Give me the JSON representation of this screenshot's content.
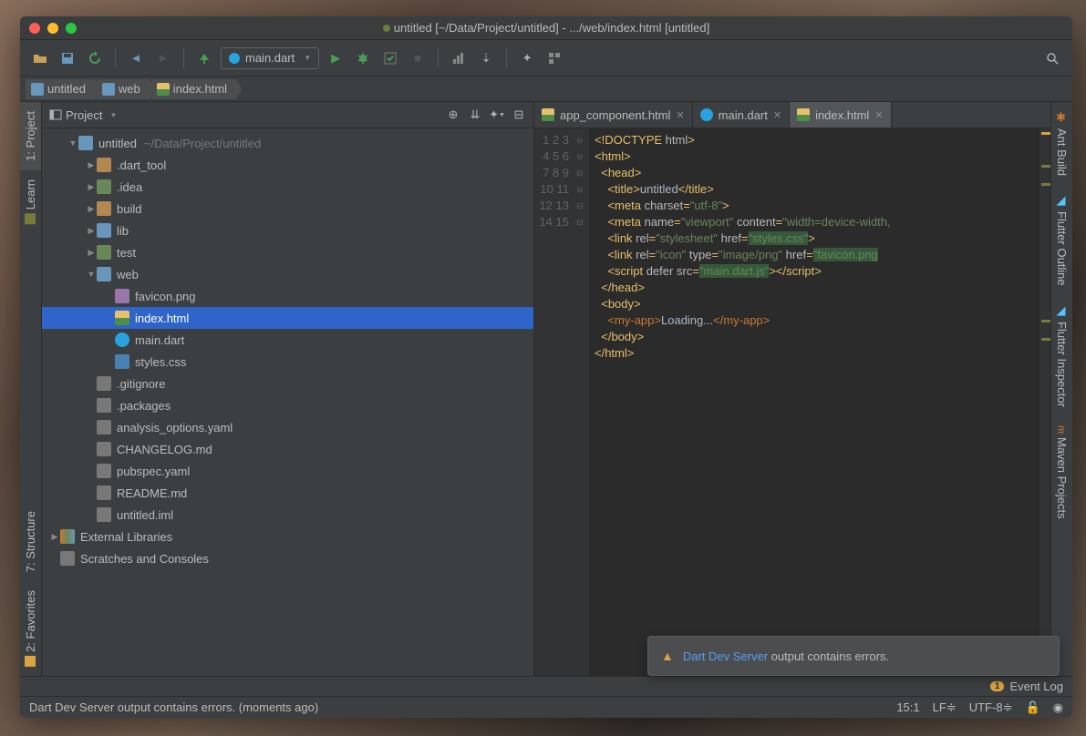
{
  "window_title": "untitled [~/Data/Project/untitled] - .../web/index.html [untitled]",
  "run_config": "main.dart",
  "breadcrumbs": [
    {
      "label": "untitled",
      "icon": "folder"
    },
    {
      "label": "web",
      "icon": "folder"
    },
    {
      "label": "index.html",
      "icon": "html"
    }
  ],
  "project_panel": {
    "title": "Project",
    "root": "untitled",
    "root_path": "~/Data/Project/untitled",
    "nodes": [
      {
        "depth": 1,
        "arrow": "down",
        "icon": "folder-b",
        "label": "untitled",
        "dim": "~/Data/Project/untitled"
      },
      {
        "depth": 2,
        "arrow": "right",
        "icon": "folder-o",
        "label": ".dart_tool"
      },
      {
        "depth": 2,
        "arrow": "right",
        "icon": "folder",
        "label": ".idea"
      },
      {
        "depth": 2,
        "arrow": "right",
        "icon": "folder-o",
        "label": "build"
      },
      {
        "depth": 2,
        "arrow": "right",
        "icon": "folder-b",
        "label": "lib"
      },
      {
        "depth": 2,
        "arrow": "right",
        "icon": "folder-g",
        "label": "test"
      },
      {
        "depth": 2,
        "arrow": "down",
        "icon": "folder-b",
        "label": "web"
      },
      {
        "depth": 3,
        "arrow": "",
        "icon": "file-p",
        "label": "favicon.png"
      },
      {
        "depth": 3,
        "arrow": "",
        "icon": "file-h",
        "label": "index.html",
        "selected": true
      },
      {
        "depth": 3,
        "arrow": "",
        "icon": "file-d",
        "label": "main.dart"
      },
      {
        "depth": 3,
        "arrow": "",
        "icon": "file-c",
        "label": "styles.css"
      },
      {
        "depth": 2,
        "arrow": "",
        "icon": "file",
        "label": ".gitignore"
      },
      {
        "depth": 2,
        "arrow": "",
        "icon": "file",
        "label": ".packages"
      },
      {
        "depth": 2,
        "arrow": "",
        "icon": "file",
        "label": "analysis_options.yaml"
      },
      {
        "depth": 2,
        "arrow": "",
        "icon": "file",
        "label": "CHANGELOG.md"
      },
      {
        "depth": 2,
        "arrow": "",
        "icon": "file",
        "label": "pubspec.yaml"
      },
      {
        "depth": 2,
        "arrow": "",
        "icon": "file",
        "label": "README.md"
      },
      {
        "depth": 2,
        "arrow": "",
        "icon": "file",
        "label": "untitled.iml"
      },
      {
        "depth": 0,
        "arrow": "right",
        "icon": "lib",
        "label": "External Libraries"
      },
      {
        "depth": 0,
        "arrow": "",
        "icon": "file",
        "label": "Scratches and Consoles"
      }
    ]
  },
  "editor_tabs": [
    {
      "label": "app_component.html",
      "icon": "html",
      "active": false
    },
    {
      "label": "main.dart",
      "icon": "dart",
      "active": false
    },
    {
      "label": "index.html",
      "icon": "html",
      "active": true
    }
  ],
  "code_html": "<span class='tag'>&lt;!DOCTYPE <span class='attr'>html</span>&gt;</span>\n<span class='tag'>&lt;html&gt;</span>\n  <span class='tag'>&lt;head&gt;</span>\n    <span class='tag'>&lt;title&gt;</span>untitled<span class='tag'>&lt;/title&gt;</span>\n    <span class='tag'>&lt;meta <span class='attr'>charset</span>=<span class='str'>\"utf-8\"</span>&gt;</span>\n    <span class='tag'>&lt;meta <span class='attr'>name</span>=<span class='str'>\"viewport\"</span> <span class='attr'>content</span>=<span class='str'>\"width=device-width,</span></span>\n    <span class='tag'>&lt;link <span class='attr'>rel</span>=<span class='str'>\"stylesheet\"</span> <span class='attr'>href</span>=<span class='strh'>\"styles.css\"</span>&gt;</span>\n    <span class='tag'>&lt;link <span class='attr'>rel</span>=<span class='str'>\"icon\"</span> <span class='attr'>type</span>=<span class='str'>\"image/png\"</span> <span class='attr'>href</span>=<span class='strh'>\"favicon.png</span></span>\n    <span class='tag'>&lt;script <span class='attr'>defer</span> <span class='attr'>src</span>=<span class='strh'>\"main.dart.js\"</span>&gt;&lt;/script&gt;</span>\n  <span class='tag'>&lt;/head&gt;</span>\n  <span class='tag'>&lt;body&gt;</span>\n    <span class='stag'>&lt;my-app&gt;</span>Loading...<span class='stag'>&lt;/my-app&gt;</span>\n  <span class='tag'>&lt;/body&gt;</span>\n<span class='tag'>&lt;/html&gt;</span>\n",
  "line_count": 15,
  "notification": {
    "link": "Dart Dev Server",
    "rest": " output contains errors."
  },
  "status": {
    "message": "Dart Dev Server output contains errors. (moments ago)",
    "cursor": "15:1",
    "line_sep": "LF",
    "encoding": "UTF-8"
  },
  "event_log": {
    "count": "1",
    "label": "Event Log"
  },
  "left_gutter": [
    {
      "label": "1: Project",
      "active": true
    },
    {
      "label": "Learn",
      "active": false
    },
    {
      "label": "7: Structure",
      "active": false
    },
    {
      "label": "2: Favorites",
      "active": false
    }
  ],
  "right_gutter": [
    {
      "label": "Ant Build"
    },
    {
      "label": "Flutter Outline"
    },
    {
      "label": "Flutter Inspector"
    },
    {
      "label": "Maven Projects"
    }
  ]
}
